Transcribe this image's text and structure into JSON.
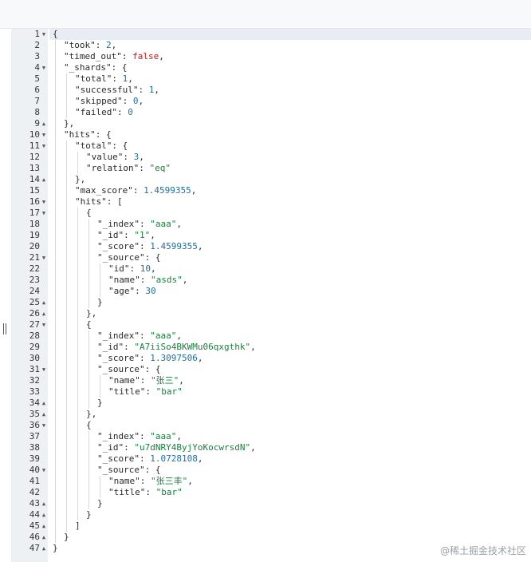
{
  "lines": [
    {
      "n": "1",
      "fold": "down",
      "indent": 0,
      "tokens": [
        {
          "t": "punc",
          "v": "{"
        }
      ]
    },
    {
      "n": "2",
      "indent": 1,
      "tokens": [
        {
          "t": "key",
          "v": "\"took\""
        },
        {
          "t": "punc",
          "v": ": "
        },
        {
          "t": "num",
          "v": "2"
        },
        {
          "t": "punc",
          "v": ","
        }
      ]
    },
    {
      "n": "3",
      "indent": 1,
      "tokens": [
        {
          "t": "key",
          "v": "\"timed_out\""
        },
        {
          "t": "punc",
          "v": ": "
        },
        {
          "t": "bool",
          "v": "false"
        },
        {
          "t": "punc",
          "v": ","
        }
      ]
    },
    {
      "n": "4",
      "fold": "down",
      "indent": 1,
      "tokens": [
        {
          "t": "key",
          "v": "\"_shards\""
        },
        {
          "t": "punc",
          "v": ": {"
        }
      ]
    },
    {
      "n": "5",
      "indent": 2,
      "tokens": [
        {
          "t": "key",
          "v": "\"total\""
        },
        {
          "t": "punc",
          "v": ": "
        },
        {
          "t": "num",
          "v": "1"
        },
        {
          "t": "punc",
          "v": ","
        }
      ]
    },
    {
      "n": "6",
      "indent": 2,
      "tokens": [
        {
          "t": "key",
          "v": "\"successful\""
        },
        {
          "t": "punc",
          "v": ": "
        },
        {
          "t": "num",
          "v": "1"
        },
        {
          "t": "punc",
          "v": ","
        }
      ]
    },
    {
      "n": "7",
      "indent": 2,
      "tokens": [
        {
          "t": "key",
          "v": "\"skipped\""
        },
        {
          "t": "punc",
          "v": ": "
        },
        {
          "t": "num",
          "v": "0"
        },
        {
          "t": "punc",
          "v": ","
        }
      ]
    },
    {
      "n": "8",
      "indent": 2,
      "tokens": [
        {
          "t": "key",
          "v": "\"failed\""
        },
        {
          "t": "punc",
          "v": ": "
        },
        {
          "t": "num",
          "v": "0"
        }
      ]
    },
    {
      "n": "9",
      "fold": "up",
      "indent": 1,
      "tokens": [
        {
          "t": "punc",
          "v": "},"
        }
      ]
    },
    {
      "n": "10",
      "fold": "down",
      "indent": 1,
      "tokens": [
        {
          "t": "key",
          "v": "\"hits\""
        },
        {
          "t": "punc",
          "v": ": {"
        }
      ]
    },
    {
      "n": "11",
      "fold": "down",
      "indent": 2,
      "tokens": [
        {
          "t": "key",
          "v": "\"total\""
        },
        {
          "t": "punc",
          "v": ": {"
        }
      ]
    },
    {
      "n": "12",
      "indent": 3,
      "tokens": [
        {
          "t": "key",
          "v": "\"value\""
        },
        {
          "t": "punc",
          "v": ": "
        },
        {
          "t": "num",
          "v": "3"
        },
        {
          "t": "punc",
          "v": ","
        }
      ]
    },
    {
      "n": "13",
      "indent": 3,
      "tokens": [
        {
          "t": "key",
          "v": "\"relation\""
        },
        {
          "t": "punc",
          "v": ": "
        },
        {
          "t": "str",
          "v": "\"eq\""
        }
      ]
    },
    {
      "n": "14",
      "fold": "up",
      "indent": 2,
      "tokens": [
        {
          "t": "punc",
          "v": "},"
        }
      ]
    },
    {
      "n": "15",
      "indent": 2,
      "tokens": [
        {
          "t": "key",
          "v": "\"max_score\""
        },
        {
          "t": "punc",
          "v": ": "
        },
        {
          "t": "num",
          "v": "1.4599355"
        },
        {
          "t": "punc",
          "v": ","
        }
      ]
    },
    {
      "n": "16",
      "fold": "down",
      "indent": 2,
      "tokens": [
        {
          "t": "key",
          "v": "\"hits\""
        },
        {
          "t": "punc",
          "v": ": ["
        }
      ]
    },
    {
      "n": "17",
      "fold": "down",
      "indent": 3,
      "tokens": [
        {
          "t": "punc",
          "v": "{"
        }
      ]
    },
    {
      "n": "18",
      "indent": 4,
      "tokens": [
        {
          "t": "key",
          "v": "\"_index\""
        },
        {
          "t": "punc",
          "v": ": "
        },
        {
          "t": "str",
          "v": "\"aaa\""
        },
        {
          "t": "punc",
          "v": ","
        }
      ]
    },
    {
      "n": "19",
      "indent": 4,
      "tokens": [
        {
          "t": "key",
          "v": "\"_id\""
        },
        {
          "t": "punc",
          "v": ": "
        },
        {
          "t": "str",
          "v": "\"1\""
        },
        {
          "t": "punc",
          "v": ","
        }
      ]
    },
    {
      "n": "20",
      "indent": 4,
      "tokens": [
        {
          "t": "key",
          "v": "\"_score\""
        },
        {
          "t": "punc",
          "v": ": "
        },
        {
          "t": "num",
          "v": "1.4599355"
        },
        {
          "t": "punc",
          "v": ","
        }
      ]
    },
    {
      "n": "21",
      "fold": "down",
      "indent": 4,
      "tokens": [
        {
          "t": "key",
          "v": "\"_source\""
        },
        {
          "t": "punc",
          "v": ": {"
        }
      ]
    },
    {
      "n": "22",
      "indent": 5,
      "tokens": [
        {
          "t": "key",
          "v": "\"id\""
        },
        {
          "t": "punc",
          "v": ": "
        },
        {
          "t": "num",
          "v": "10"
        },
        {
          "t": "punc",
          "v": ","
        }
      ]
    },
    {
      "n": "23",
      "indent": 5,
      "tokens": [
        {
          "t": "key",
          "v": "\"name\""
        },
        {
          "t": "punc",
          "v": ": "
        },
        {
          "t": "str",
          "v": "\"asds\""
        },
        {
          "t": "punc",
          "v": ","
        }
      ]
    },
    {
      "n": "24",
      "indent": 5,
      "tokens": [
        {
          "t": "key",
          "v": "\"age\""
        },
        {
          "t": "punc",
          "v": ": "
        },
        {
          "t": "num",
          "v": "30"
        }
      ]
    },
    {
      "n": "25",
      "fold": "up",
      "indent": 4,
      "tokens": [
        {
          "t": "punc",
          "v": "}"
        }
      ]
    },
    {
      "n": "26",
      "fold": "up",
      "indent": 3,
      "tokens": [
        {
          "t": "punc",
          "v": "},"
        }
      ]
    },
    {
      "n": "27",
      "fold": "down",
      "indent": 3,
      "tokens": [
        {
          "t": "punc",
          "v": "{"
        }
      ]
    },
    {
      "n": "28",
      "indent": 4,
      "tokens": [
        {
          "t": "key",
          "v": "\"_index\""
        },
        {
          "t": "punc",
          "v": ": "
        },
        {
          "t": "str",
          "v": "\"aaa\""
        },
        {
          "t": "punc",
          "v": ","
        }
      ]
    },
    {
      "n": "29",
      "indent": 4,
      "tokens": [
        {
          "t": "key",
          "v": "\"_id\""
        },
        {
          "t": "punc",
          "v": ": "
        },
        {
          "t": "str",
          "v": "\"A7iiSo4BKWMu06qxgthk\""
        },
        {
          "t": "punc",
          "v": ","
        }
      ]
    },
    {
      "n": "30",
      "indent": 4,
      "tokens": [
        {
          "t": "key",
          "v": "\"_score\""
        },
        {
          "t": "punc",
          "v": ": "
        },
        {
          "t": "num",
          "v": "1.3097506"
        },
        {
          "t": "punc",
          "v": ","
        }
      ]
    },
    {
      "n": "31",
      "fold": "down",
      "indent": 4,
      "tokens": [
        {
          "t": "key",
          "v": "\"_source\""
        },
        {
          "t": "punc",
          "v": ": {"
        }
      ]
    },
    {
      "n": "32",
      "indent": 5,
      "tokens": [
        {
          "t": "key",
          "v": "\"name\""
        },
        {
          "t": "punc",
          "v": ": "
        },
        {
          "t": "str",
          "v": "\"张三\""
        },
        {
          "t": "punc",
          "v": ","
        }
      ]
    },
    {
      "n": "33",
      "indent": 5,
      "tokens": [
        {
          "t": "key",
          "v": "\"title\""
        },
        {
          "t": "punc",
          "v": ": "
        },
        {
          "t": "str",
          "v": "\"bar\""
        }
      ]
    },
    {
      "n": "34",
      "fold": "up",
      "indent": 4,
      "tokens": [
        {
          "t": "punc",
          "v": "}"
        }
      ]
    },
    {
      "n": "35",
      "fold": "up",
      "indent": 3,
      "tokens": [
        {
          "t": "punc",
          "v": "},"
        }
      ]
    },
    {
      "n": "36",
      "fold": "down",
      "indent": 3,
      "tokens": [
        {
          "t": "punc",
          "v": "{"
        }
      ]
    },
    {
      "n": "37",
      "indent": 4,
      "tokens": [
        {
          "t": "key",
          "v": "\"_index\""
        },
        {
          "t": "punc",
          "v": ": "
        },
        {
          "t": "str",
          "v": "\"aaa\""
        },
        {
          "t": "punc",
          "v": ","
        }
      ]
    },
    {
      "n": "38",
      "indent": 4,
      "tokens": [
        {
          "t": "key",
          "v": "\"_id\""
        },
        {
          "t": "punc",
          "v": ": "
        },
        {
          "t": "str",
          "v": "\"u7dNRY4ByjYoKocwrsdN\""
        },
        {
          "t": "punc",
          "v": ","
        }
      ]
    },
    {
      "n": "39",
      "indent": 4,
      "tokens": [
        {
          "t": "key",
          "v": "\"_score\""
        },
        {
          "t": "punc",
          "v": ": "
        },
        {
          "t": "num",
          "v": "1.0728108"
        },
        {
          "t": "punc",
          "v": ","
        }
      ]
    },
    {
      "n": "40",
      "fold": "down",
      "indent": 4,
      "tokens": [
        {
          "t": "key",
          "v": "\"_source\""
        },
        {
          "t": "punc",
          "v": ": {"
        }
      ]
    },
    {
      "n": "41",
      "indent": 5,
      "tokens": [
        {
          "t": "key",
          "v": "\"name\""
        },
        {
          "t": "punc",
          "v": ": "
        },
        {
          "t": "str",
          "v": "\"张三丰\""
        },
        {
          "t": "punc",
          "v": ","
        }
      ]
    },
    {
      "n": "42",
      "indent": 5,
      "tokens": [
        {
          "t": "key",
          "v": "\"title\""
        },
        {
          "t": "punc",
          "v": ": "
        },
        {
          "t": "str",
          "v": "\"bar\""
        }
      ]
    },
    {
      "n": "43",
      "fold": "up",
      "indent": 4,
      "tokens": [
        {
          "t": "punc",
          "v": "}"
        }
      ]
    },
    {
      "n": "44",
      "fold": "up",
      "indent": 3,
      "tokens": [
        {
          "t": "punc",
          "v": "}"
        }
      ]
    },
    {
      "n": "45",
      "fold": "up",
      "indent": 2,
      "tokens": [
        {
          "t": "punc",
          "v": "]"
        }
      ]
    },
    {
      "n": "46",
      "fold": "up",
      "indent": 1,
      "tokens": [
        {
          "t": "punc",
          "v": "}"
        }
      ]
    },
    {
      "n": "47",
      "fold": "up",
      "indent": 0,
      "tokens": [
        {
          "t": "punc",
          "v": "}"
        }
      ]
    }
  ],
  "fold_icons": {
    "down": "▼",
    "up": "▲"
  },
  "colors": {
    "string": "#1a7f3c",
    "number": "#1d6fa8",
    "boolean": "#c41a16",
    "key": "#2a2a2a"
  },
  "watermark": "@稀土掘金技术社区"
}
